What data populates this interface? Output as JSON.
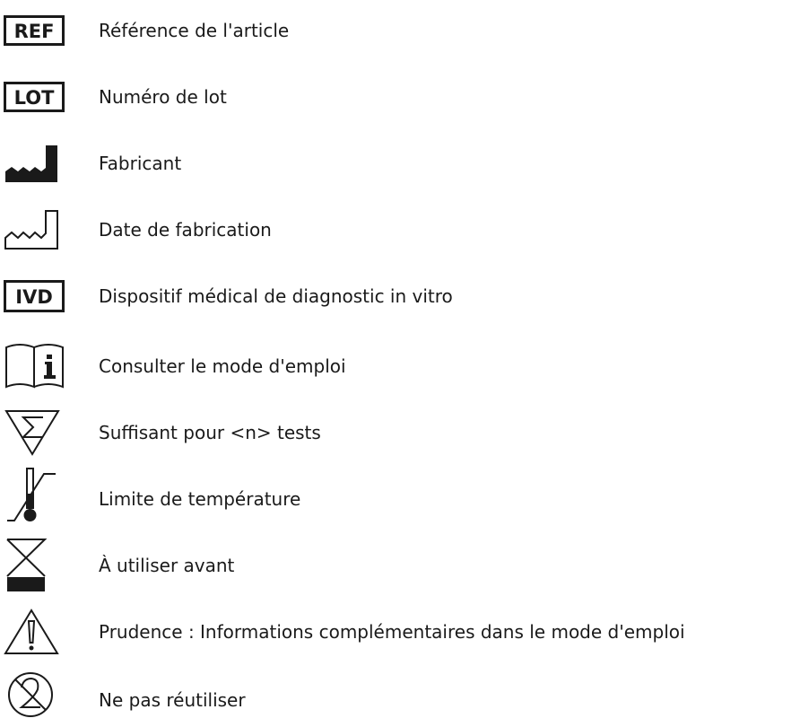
{
  "symbols": [
    {
      "icon": "ref-catalogue-number-icon",
      "code": "REF",
      "label": "Référence de l'article"
    },
    {
      "icon": "lot-batch-code-icon",
      "code": "LOT",
      "label": "Numéro de lot"
    },
    {
      "icon": "manufacturer-factory-icon",
      "label": "Fabricant"
    },
    {
      "icon": "date-of-manufacture-icon",
      "label": "Date de fabrication"
    },
    {
      "icon": "ivd-device-icon",
      "code": "IVD",
      "label": "Dispositif médical de diagnostic in vitro"
    },
    {
      "icon": "instructions-for-use-icon",
      "label": "Consulter le mode d'emploi"
    },
    {
      "icon": "sufficient-for-tests-icon",
      "label": "Suffisant pour <n> tests"
    },
    {
      "icon": "temperature-limit-icon",
      "label": "Limite de température"
    },
    {
      "icon": "hourglass-use-by-icon",
      "label": "À utiliser avant"
    },
    {
      "icon": "caution-warning-icon",
      "label": "Prudence : Informations complémentaires dans le mode d'emploi"
    },
    {
      "icon": "do-not-reuse-icon",
      "label": "Ne pas réutiliser"
    }
  ]
}
